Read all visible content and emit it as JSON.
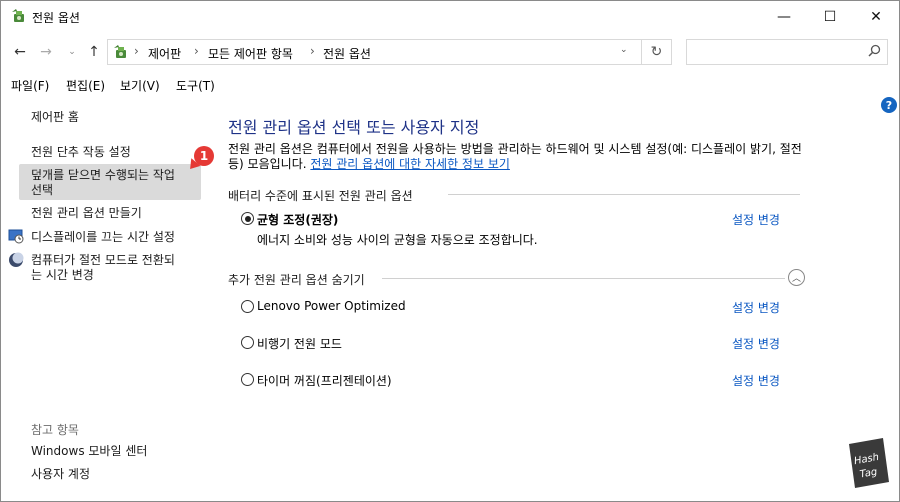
{
  "window": {
    "title": "전원 옵션",
    "min_glyph": "—",
    "max_glyph": "☐",
    "close_glyph": "✕"
  },
  "nav": {
    "back_glyph": "←",
    "forward_glyph": "→",
    "dropdown_glyph": "⌄",
    "up_glyph": "↑",
    "breadcrumb": [
      "제어판",
      "모든 제어판 항목",
      "전원 옵션"
    ],
    "separator": "›",
    "refresh_glyph": "↻",
    "search_placeholder": "",
    "search_glyph": "⚲"
  },
  "menu": {
    "items": [
      "파일(F)",
      "편집(E)",
      "보기(V)",
      "도구(T)"
    ]
  },
  "left": {
    "home": "제어판 홈",
    "links": [
      "전원 단추 작동 설정",
      "덮개를 닫으면 수행되는 작업\n선택",
      "전원 관리 옵션 만들기",
      "디스플레이를 끄는 시간 설정",
      "컴퓨터가 절전 모드로 전환되\n는 시간 변경"
    ],
    "see_also_title": "참고 항목",
    "see_also": [
      "Windows 모바일 센터",
      "사용자 계정"
    ]
  },
  "badge": {
    "number": "1",
    "color": "#e53935"
  },
  "main": {
    "title": "전원 관리 옵션 선택 또는 사용자 지정",
    "desc_text": "전원 관리 옵션은 컴퓨터에서 전원을 사용하는 방법을 관리하는 하드웨어 및 시스템 설정(예: 디스플레이 밝기, 절전 등) 모음입니다. ",
    "desc_link": "전원 관리 옵션에 대한 자세한 정보 보기",
    "help_glyph": "?",
    "battery_section": "배터리 수준에 표시된 전원 관리 옵션",
    "plan_selected": {
      "name": "균형 조정(권장)",
      "desc": "에너지 소비와 성능 사이의 균형을 자동으로 조정합니다.",
      "change": "설정 변경"
    },
    "extra_section": "추가 전원 관리 옵션 숨기기",
    "collapse_glyph": "︿",
    "plans": [
      {
        "name": "Lenovo Power Optimized",
        "change": "설정 변경"
      },
      {
        "name": "비행기 전원 모드",
        "change": "설정 변경"
      },
      {
        "name": "타이머 꺼짐(프리젠테이션)",
        "change": "설정 변경"
      }
    ]
  },
  "watermark": {
    "text_line1": "Hash",
    "text_line2": "Tag"
  },
  "colors": {
    "title_blue": "#1e3287",
    "link_blue": "#0a57c2",
    "highlight": "#dadada"
  }
}
